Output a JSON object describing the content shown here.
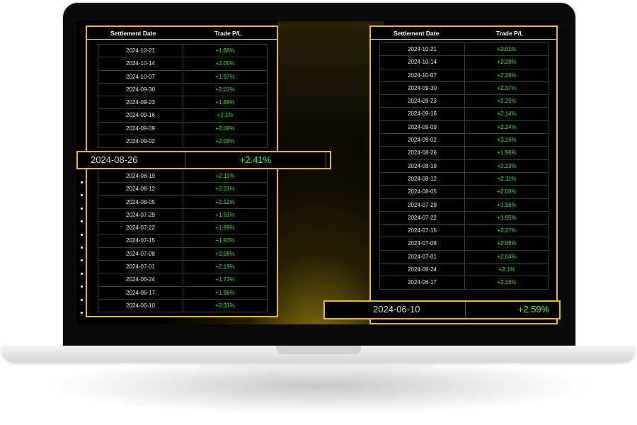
{
  "left_table": {
    "col_date": "Settlement Date",
    "col_pl": "Trade P/L",
    "rows_top": [
      {
        "date": "2024-10-21",
        "pl": "+1.88%"
      },
      {
        "date": "2024-10-14",
        "pl": "+2.05%"
      },
      {
        "date": "2024-10-07",
        "pl": "+1.97%"
      },
      {
        "date": "2024-09-30",
        "pl": "+2.03%"
      },
      {
        "date": "2024-09-23",
        "pl": "+1.88%"
      },
      {
        "date": "2024-09-16",
        "pl": "+2.1%"
      },
      {
        "date": "2024-09-09",
        "pl": "+2.08%"
      },
      {
        "date": "2024-09-02",
        "pl": "+2.08%"
      }
    ],
    "rows_bottom": [
      {
        "date": "2024-08-19",
        "pl": "+2.11%"
      },
      {
        "date": "2024-08-12",
        "pl": "+2.31%"
      },
      {
        "date": "2024-08-05",
        "pl": "+2.12%"
      },
      {
        "date": "2024-07-29",
        "pl": "+1.91%"
      },
      {
        "date": "2024-07-22",
        "pl": "+1.99%"
      },
      {
        "date": "2024-07-15",
        "pl": "+1.93%"
      },
      {
        "date": "2024-07-08",
        "pl": "+2.08%"
      },
      {
        "date": "2024-07-01",
        "pl": "+2.19%"
      },
      {
        "date": "2024-06-24",
        "pl": "+1.73%"
      },
      {
        "date": "2024-06-17",
        "pl": "+1.96%"
      },
      {
        "date": "2024-06-10",
        "pl": "+2.31%"
      }
    ],
    "callout": {
      "date": "2024-08-26",
      "pl": "+2.41%"
    }
  },
  "right_table": {
    "col_date": "Settlement Date",
    "col_pl": "Trade P/L",
    "rows": [
      {
        "date": "2024-10-21",
        "pl": "+2.01%"
      },
      {
        "date": "2024-10-14",
        "pl": "+2.28%"
      },
      {
        "date": "2024-10-07",
        "pl": "+2.28%"
      },
      {
        "date": "2024-09-30",
        "pl": "+2.37%"
      },
      {
        "date": "2024-09-23",
        "pl": "+2.25%"
      },
      {
        "date": "2024-09-16",
        "pl": "+2.14%"
      },
      {
        "date": "2024-09-09",
        "pl": "+2.24%"
      },
      {
        "date": "2024-09-02",
        "pl": "+2.16%"
      },
      {
        "date": "2024-08-26",
        "pl": "+1.96%"
      },
      {
        "date": "2024-08-19",
        "pl": "+2.23%"
      },
      {
        "date": "2024-08-12",
        "pl": "+2.11%"
      },
      {
        "date": "2024-08-05",
        "pl": "+2.08%"
      },
      {
        "date": "2024-07-29",
        "pl": "+1.96%"
      },
      {
        "date": "2024-07-22",
        "pl": "+1.95%"
      },
      {
        "date": "2024-07-15",
        "pl": "+2.27%"
      },
      {
        "date": "2024-07-08",
        "pl": "+2.06%"
      },
      {
        "date": "2024-07-01",
        "pl": "+2.04%"
      },
      {
        "date": "2024-06-24",
        "pl": "+2.1%"
      },
      {
        "date": "2024-06-17",
        "pl": "+2.16%"
      }
    ],
    "callout": {
      "date": "2024-06-10",
      "pl": "+2.59%"
    }
  },
  "colors": {
    "accent": "#e8b92b",
    "positive": "#38e038",
    "background": "#000000"
  }
}
